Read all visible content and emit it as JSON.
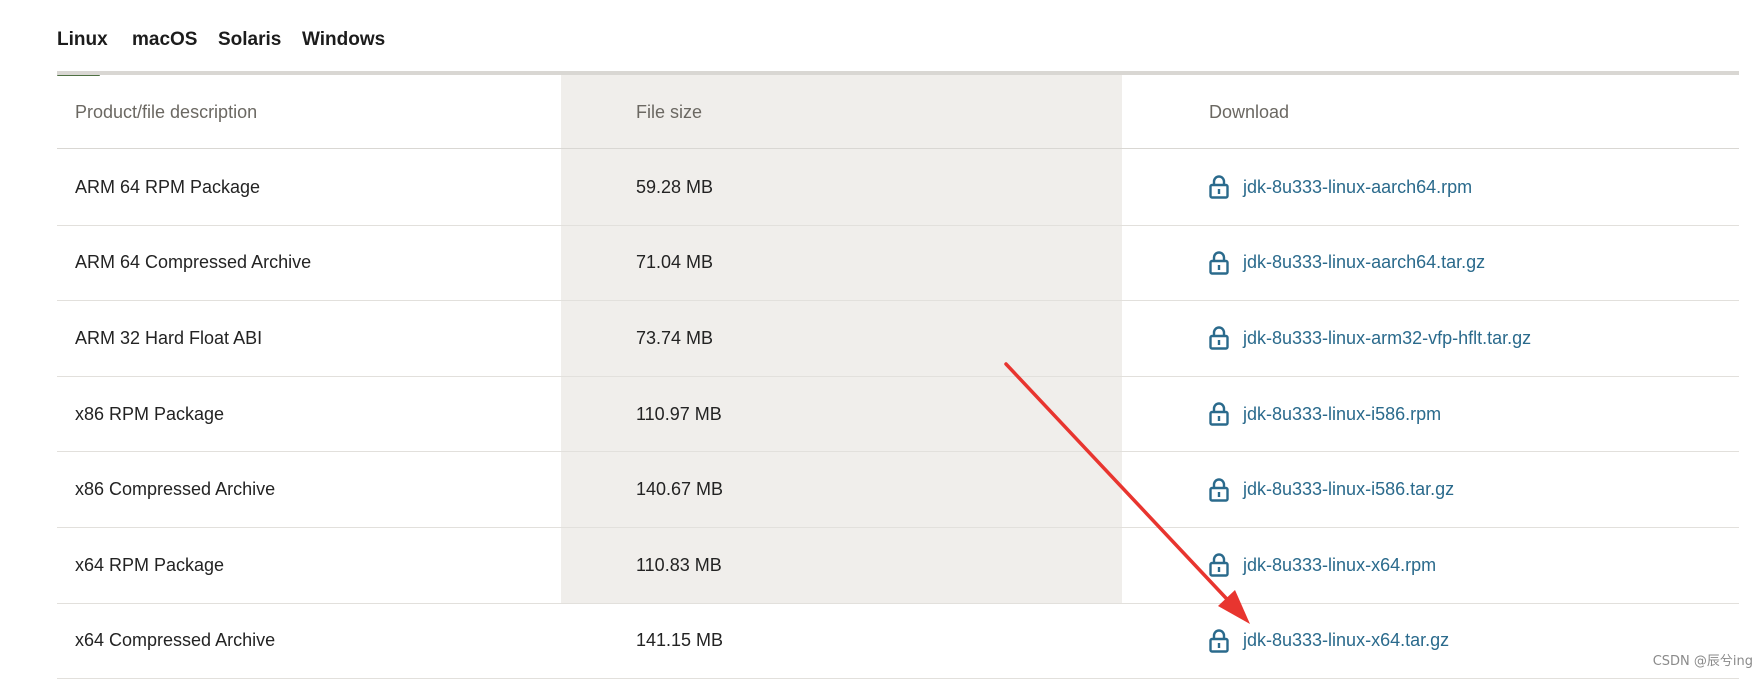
{
  "tabs": [
    {
      "label": "Linux",
      "active": true
    },
    {
      "label": "macOS",
      "active": false
    },
    {
      "label": "Solaris",
      "active": false
    },
    {
      "label": "Windows",
      "active": false
    }
  ],
  "table": {
    "headers": {
      "description": "Product/file description",
      "size": "File size",
      "download": "Download"
    },
    "rows": [
      {
        "description": "ARM 64 RPM Package",
        "size": "59.28 MB",
        "file": "jdk-8u333-linux-aarch64.rpm",
        "icon": "lock-icon"
      },
      {
        "description": "ARM 64 Compressed Archive",
        "size": "71.04 MB",
        "file": "jdk-8u333-linux-aarch64.tar.gz",
        "icon": "lock-icon"
      },
      {
        "description": "ARM 32 Hard Float ABI",
        "size": "73.74 MB",
        "file": "jdk-8u333-linux-arm32-vfp-hflt.tar.gz",
        "icon": "lock-icon"
      },
      {
        "description": "x86 RPM Package",
        "size": "110.97 MB",
        "file": "jdk-8u333-linux-i586.rpm",
        "icon": "lock-icon"
      },
      {
        "description": "x86 Compressed Archive",
        "size": "140.67 MB",
        "file": "jdk-8u333-linux-i586.tar.gz",
        "icon": "lock-icon"
      },
      {
        "description": "x64 RPM Package",
        "size": "110.83 MB",
        "file": "jdk-8u333-linux-x64.rpm",
        "icon": "lock-icon"
      },
      {
        "description": "x64 Compressed Archive",
        "size": "141.15 MB",
        "file": "jdk-8u333-linux-x64.tar.gz",
        "icon": "lock-icon"
      }
    ]
  },
  "annotation": {
    "type": "arrow",
    "color": "#e8352f",
    "points_to": "jdk-8u333-linux-x64.tar.gz"
  },
  "watermark": "CSDN @辰兮ing",
  "colors": {
    "tab_active_underline": "#4e7043",
    "link": "#2a6a8c",
    "size_column_bg": "#f0eeeb",
    "header_text": "#6b6862"
  }
}
